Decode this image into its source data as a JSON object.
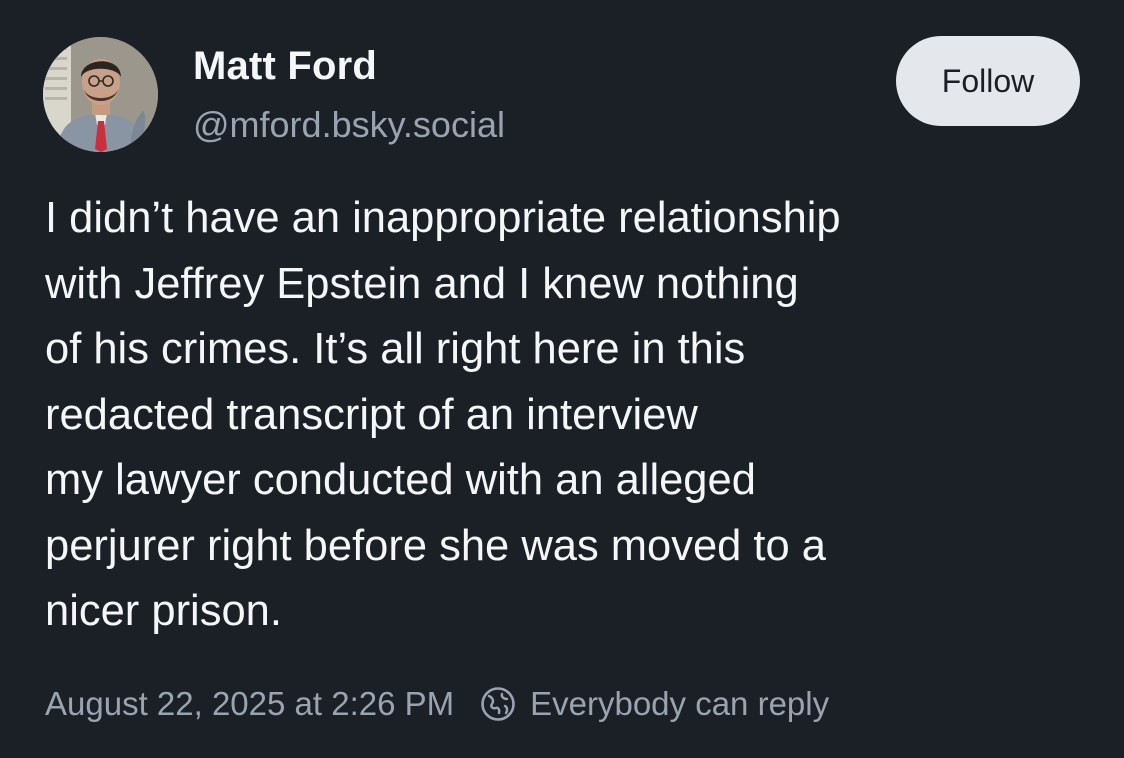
{
  "author": {
    "display_name": "Matt Ford",
    "handle": "@mford.bsky.social"
  },
  "actions": {
    "follow_label": "Follow"
  },
  "post": {
    "lines": [
      "I didn’t have an inappropriate relationship",
      "with Jeffrey Epstein and I knew nothing",
      "of his crimes. It’s all right here in this",
      "redacted transcript of an interview",
      "my lawyer conducted with an alleged",
      "perjurer right before she was moved to a",
      "nicer prison."
    ],
    "timestamp": "August 22, 2025 at 2:26 PM",
    "reply_setting": "Everybody can reply"
  },
  "icons": {
    "reply_setting_icon": "globe-icon"
  },
  "colors": {
    "background": "#1b1f26",
    "text_primary": "#f4f6f8",
    "text_secondary": "#9aa4b1",
    "follow_button_bg": "#e4e7eb"
  }
}
